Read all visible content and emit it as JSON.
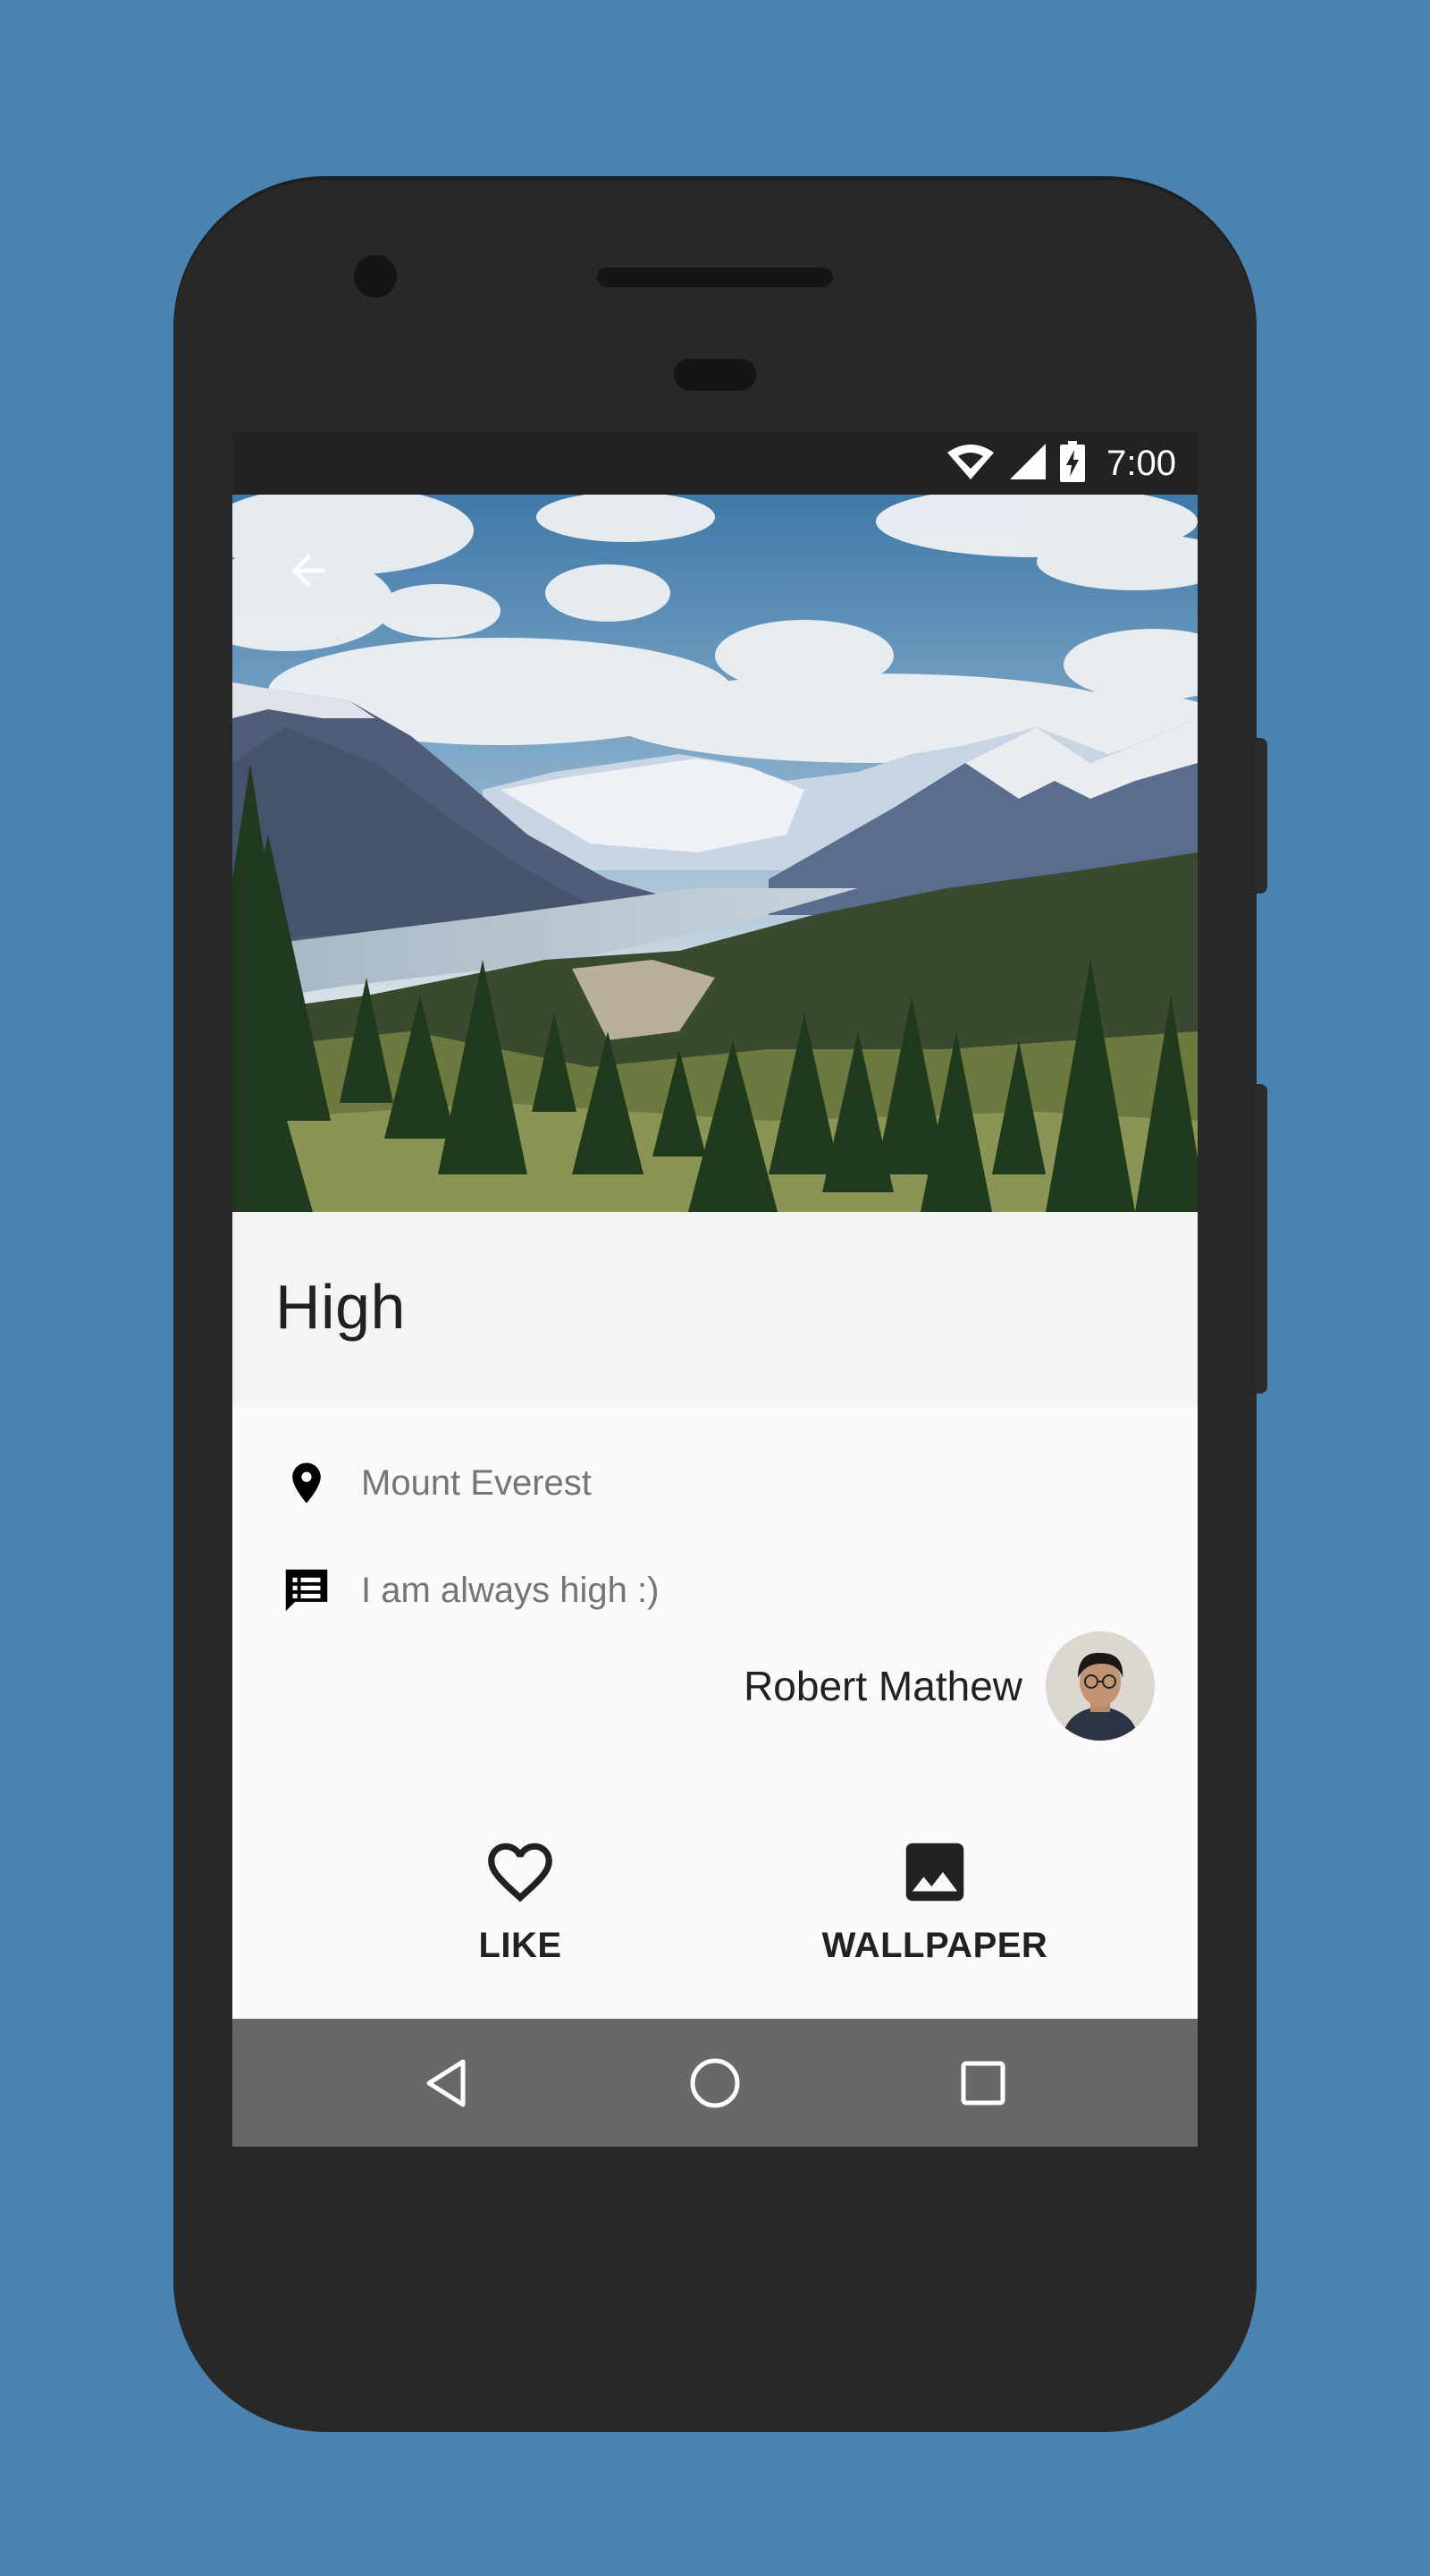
{
  "status_bar": {
    "time": "7:00",
    "icons": [
      "wifi-icon",
      "cell-signal-icon",
      "battery-charging-icon"
    ]
  },
  "toolbar": {
    "back_icon": "arrow-left-icon"
  },
  "post": {
    "title": "High",
    "location": "Mount Everest",
    "description": "I am always high :)",
    "author_name": "Robert Mathew"
  },
  "actions": {
    "like_label": "LIKE",
    "wallpaper_label": "WALLPAPER"
  },
  "nav_bar": {
    "buttons": [
      "back-triangle-icon",
      "home-circle-icon",
      "recents-square-icon"
    ]
  },
  "colors": {
    "background": "#4a82b0",
    "phone_body": "#282828",
    "title_band": "#f4f4f4",
    "nav_bar": "#686868"
  }
}
